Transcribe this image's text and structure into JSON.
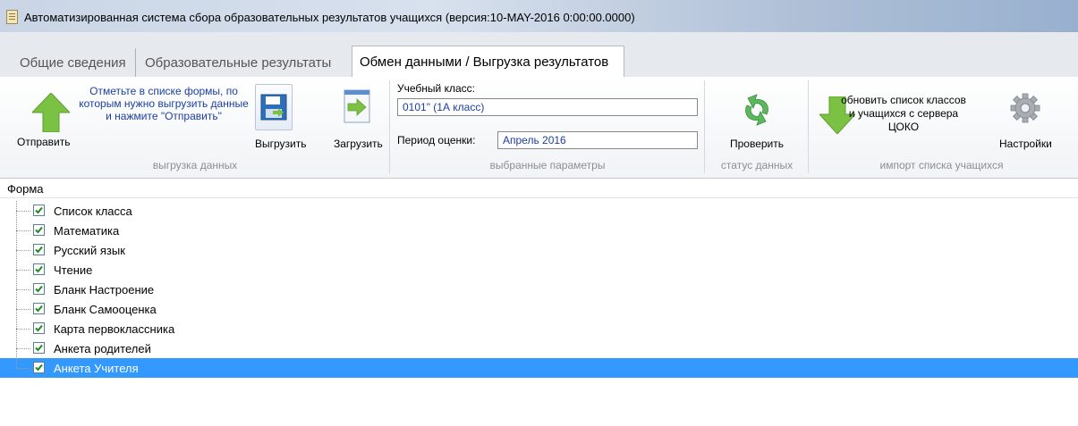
{
  "window": {
    "title": "Автоматизированная система сбора образовательных результатов учащихся (версия:10-MAY-2016 0:00:00.0000)",
    "icon": "document-icon"
  },
  "tabs": [
    {
      "label": "Общие сведения",
      "active": false
    },
    {
      "label": "Образовательные результаты",
      "active": false
    },
    {
      "label": "Обмен данными / Выгрузка результатов",
      "active": true
    }
  ],
  "ribbon": {
    "export_group": {
      "label": "выгрузка данных",
      "send_label": "Отправить",
      "note": "Отметьте в списке формы, по которым нужно выгрузить данные и нажмите \"Отправить\"",
      "unload_label": "Выгрузить",
      "load_label": "Загрузить"
    },
    "params_group": {
      "label": "выбранные параметры",
      "class_label": "Учебный класс:",
      "class_value": "0101\" (1А класс)",
      "period_label": "Период оценки:",
      "period_value": "Апрель 2016"
    },
    "status_group": {
      "label": "статус данных",
      "check_label": "Проверить"
    },
    "import_group": {
      "label": "импорт списка учащихся",
      "note": "обновить список классов и учащихся с сервера ЦОКО",
      "settings_label": "Настройки"
    },
    "colors": {
      "arrow_green": "#7bc143",
      "refresh_green": "#5cb85c",
      "note_blue": "#1c3fa0"
    }
  },
  "tree": {
    "header": "Форма",
    "items": [
      {
        "label": "Список класса",
        "checked": true,
        "selected": false
      },
      {
        "label": "Математика",
        "checked": true,
        "selected": false
      },
      {
        "label": "Русский язык",
        "checked": true,
        "selected": false
      },
      {
        "label": "Чтение",
        "checked": true,
        "selected": false
      },
      {
        "label": "Бланк Настроение",
        "checked": true,
        "selected": false
      },
      {
        "label": "Бланк Самооценка",
        "checked": true,
        "selected": false
      },
      {
        "label": "Карта первоклассника",
        "checked": true,
        "selected": false
      },
      {
        "label": "Анкета родителей",
        "checked": true,
        "selected": false
      },
      {
        "label": "Анкета Учителя",
        "checked": true,
        "selected": true
      }
    ],
    "selection_color": "#3399ff"
  }
}
